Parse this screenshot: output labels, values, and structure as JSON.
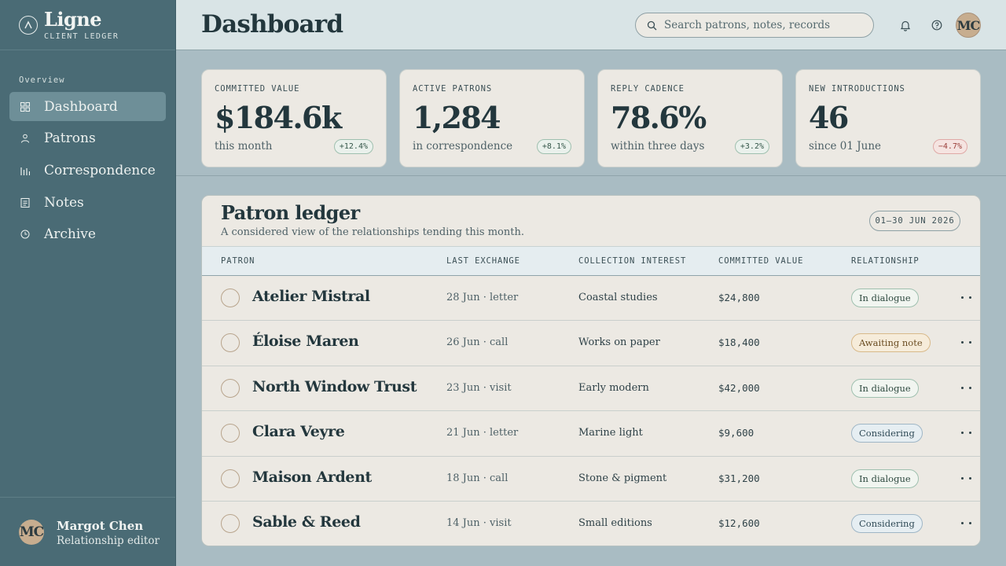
{
  "brand": {
    "name": "Ligne",
    "sub": "CLIENT LEDGER"
  },
  "sidebar": {
    "section": "Overview",
    "items": [
      {
        "label": "Dashboard",
        "icon": "grid-icon",
        "active": true
      },
      {
        "label": "Patrons",
        "icon": "person-icon"
      },
      {
        "label": "Correspondence",
        "icon": "bars-icon"
      },
      {
        "label": "Notes",
        "icon": "note-icon"
      },
      {
        "label": "Archive",
        "icon": "clock-icon"
      }
    ],
    "user": {
      "initials": "MC",
      "name": "Margot Chen",
      "role": "Relationship editor"
    }
  },
  "header": {
    "title": "Dashboard",
    "search_placeholder": "Search patrons, notes, records",
    "avatar": "MC"
  },
  "kpis": [
    {
      "label": "COMMITTED VALUE",
      "value": "$184.6k",
      "sub": "this month",
      "delta": "+12.4%",
      "negative": false
    },
    {
      "label": "ACTIVE PATRONS",
      "value": "1,284",
      "sub": "in correspondence",
      "delta": "+8.1%",
      "negative": false
    },
    {
      "label": "REPLY CADENCE",
      "value": "78.6%",
      "sub": "within three days",
      "delta": "+3.2%",
      "negative": false
    },
    {
      "label": "NEW INTRODUCTIONS",
      "value": "46",
      "sub": "since 01 June",
      "delta": "−4.7%",
      "negative": true
    }
  ],
  "ledger": {
    "title": "Patron ledger",
    "subtitle": "A considered view of the relationships tending this month.",
    "range": "01–30 JUN 2026",
    "columns": [
      "PATRON",
      "LAST EXCHANGE",
      "COLLECTION INTEREST",
      "COMMITTED VALUE",
      "RELATIONSHIP"
    ],
    "rows": [
      {
        "patron": "Atelier Mistral",
        "exchange": "28 Jun · letter",
        "interest": "Coastal studies",
        "value": "$24,800",
        "status": "In dialogue",
        "tone": "green"
      },
      {
        "patron": "Éloise Maren",
        "exchange": "26 Jun · call",
        "interest": "Works on paper",
        "value": "$18,400",
        "status": "Awaiting note",
        "tone": "amber"
      },
      {
        "patron": "North Window Trust",
        "exchange": "23 Jun · visit",
        "interest": "Early modern",
        "value": "$42,000",
        "status": "In dialogue",
        "tone": "green"
      },
      {
        "patron": "Clara Veyre",
        "exchange": "21 Jun · letter",
        "interest": "Marine light",
        "value": "$9,600",
        "status": "Considering",
        "tone": "blue"
      },
      {
        "patron": "Maison Ardent",
        "exchange": "18 Jun · call",
        "interest": "Stone & pigment",
        "value": "$31,200",
        "status": "In dialogue",
        "tone": "green"
      },
      {
        "patron": "Sable & Reed",
        "exchange": "14 Jun · visit",
        "interest": "Small editions",
        "value": "$12,600",
        "status": "Considering",
        "tone": "blue"
      }
    ]
  }
}
